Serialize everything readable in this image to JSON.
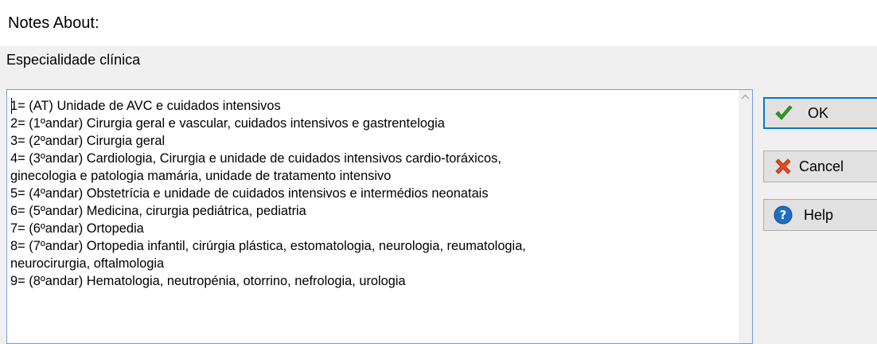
{
  "dialog": {
    "title": "Notes About:",
    "subject": "Especialidade clínica"
  },
  "notes": {
    "text": "1= (AT) Unidade de AVC e cuidados intensivos\n2= (1ºandar) Cirurgia geral e vascular, cuidados intensivos e gastrentelogia\n3= (2ºandar) Cirurgia geral\n4= (3ºandar) Cardiologia, Cirurgia e unidade de cuidados intensivos cardio-toráxicos,\nginecologia e patologia mamária, unidade de tratamento intensivo\n5= (4ºandar) Obstetrícia e unidade de cuidados intensivos e intermédios neonatais\n6= (5ºandar) Medicina, cirurgia pediátrica, pediatria\n7= (6ºandar) Ortopedia\n8= (7ºandar) Ortopedia infantil, cirúrgia plástica, estomatologia, neurologia, reumatologia,\nneurocirurgia, oftalmologia\n9= (8ºandar) Hematologia, neutropénia, otorrino, nefrologia, urologia"
  },
  "buttons": {
    "ok": {
      "label": "OK",
      "icon": "checkmark-icon",
      "color": "#2e9e1f"
    },
    "cancel": {
      "label": "Cancel",
      "icon": "cross-icon",
      "color": "#e8491d"
    },
    "help": {
      "label": "Help",
      "icon": "help-icon",
      "color": "#1e6fc4"
    }
  }
}
